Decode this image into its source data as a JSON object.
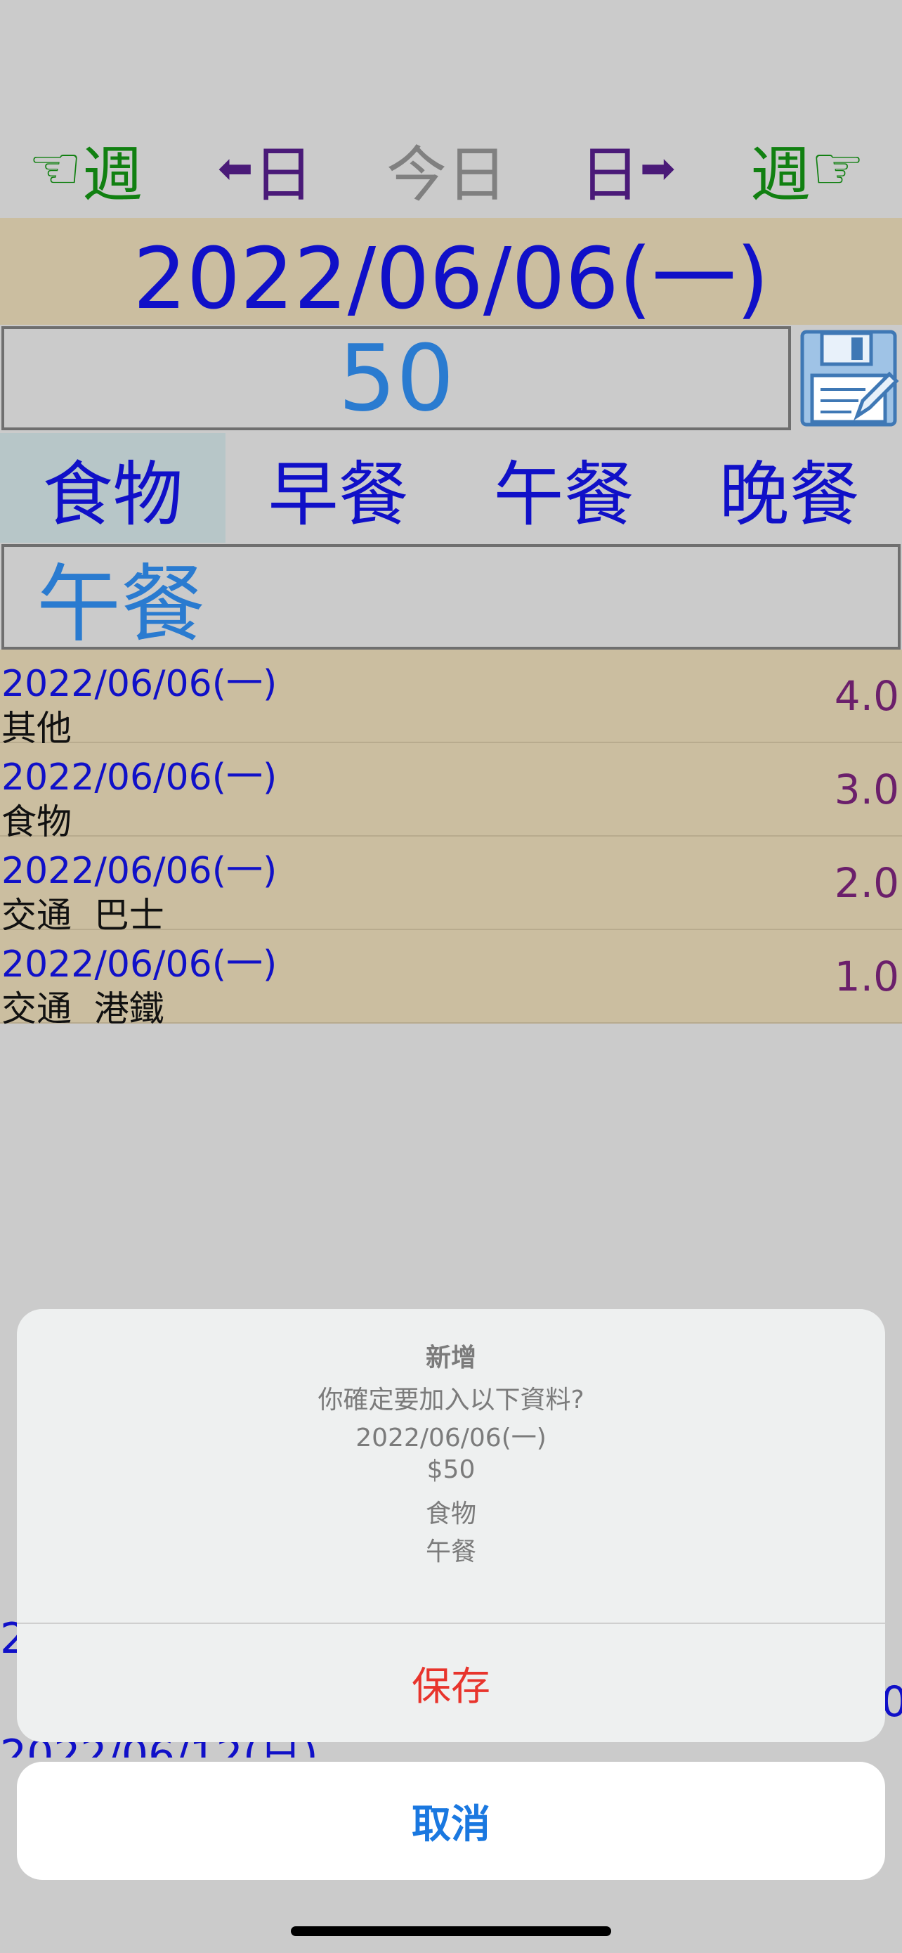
{
  "nav": {
    "prev_week": {
      "icon": "☜",
      "label": "週"
    },
    "prev_day": {
      "icon": "⬅",
      "label": "日"
    },
    "today": {
      "label": "今日"
    },
    "next_day": {
      "label": "日",
      "icon": "➡"
    },
    "next_week": {
      "label": "週",
      "icon": "☞"
    }
  },
  "date_display": "2022/06/06(一)",
  "amount": "50",
  "categories": [
    {
      "label": "食物",
      "active": true
    },
    {
      "label": "早餐",
      "active": false
    },
    {
      "label": "午餐",
      "active": false
    },
    {
      "label": "晚餐",
      "active": false
    }
  ],
  "selected_sub": "午餐",
  "records": [
    {
      "date": "2022/06/06(一)",
      "category": "其他",
      "value": "4.0"
    },
    {
      "date": "2022/06/06(一)",
      "category": "食物",
      "value": "3.0"
    },
    {
      "date": "2022/06/06(一)",
      "category": "交通  巴士",
      "value": "2.0"
    },
    {
      "date": "2022/06/06(一)",
      "category": "交通  港鐵",
      "value": "1.0"
    }
  ],
  "dialog": {
    "title": "新增",
    "message_lines": [
      "你確定要加入以下資料?",
      "2022/06/06(一)",
      "$50",
      "食物",
      "午餐"
    ],
    "save_label": "保存",
    "cancel_label": "取消"
  },
  "colors": {
    "background": "#cbcbcb",
    "row_tan": "#cbbea0",
    "date_blue": "#1010c8",
    "amount_blue": "#2a7bd0",
    "save_red": "#e8342c",
    "cancel_blue": "#1a78e0"
  }
}
